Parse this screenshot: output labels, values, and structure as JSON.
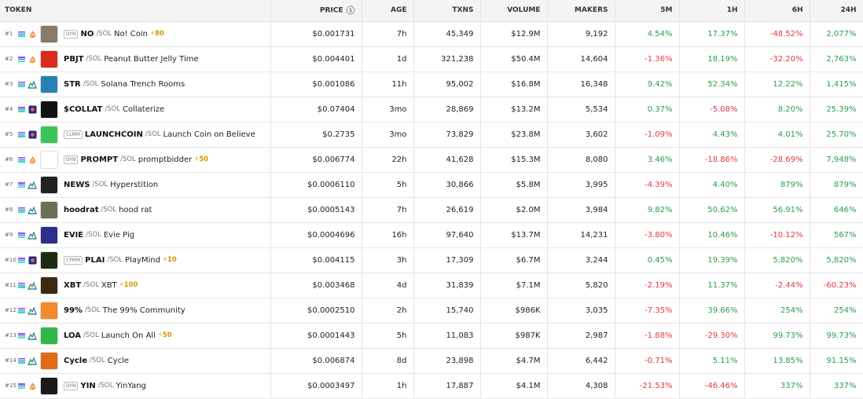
{
  "columns": {
    "token": "TOKEN",
    "price": "PRICE",
    "age": "AGE",
    "txns": "TXNS",
    "volume": "VOLUME",
    "makers": "MAKERS",
    "m5": "5M",
    "h1": "1H",
    "h6": "6H",
    "h24": "24H"
  },
  "colors": {
    "positive": "#2a9d4f",
    "negative": "#e0393e",
    "boost": "#d19a00",
    "header_bg": "#f4f4f5"
  },
  "rows": [
    {
      "rank": "#1",
      "dex": "fire-icon",
      "badge": "DYN",
      "symbol": "NO",
      "pair": "/SOL",
      "name": "No! Coin",
      "boost": "⚡80",
      "avatar_color": "#8a7a6a",
      "price": "$0.001731",
      "age": "7h",
      "txns": "45,349",
      "volume": "$12.9M",
      "makers": "9,192",
      "m5": "4.54%",
      "h1": "17.37%",
      "h6": "-48.52%",
      "h24": "2,077%"
    },
    {
      "rank": "#2",
      "dex": "fire-icon",
      "badge": "",
      "symbol": "PBJT",
      "pair": "/SOL",
      "name": "Peanut Butter Jelly Time",
      "boost": "",
      "avatar_color": "#d92c1c",
      "price": "$0.004401",
      "age": "1d",
      "txns": "321,238",
      "volume": "$50.4M",
      "makers": "14,604",
      "m5": "-1.36%",
      "h1": "18.19%",
      "h6": "-32.20%",
      "h24": "2,763%"
    },
    {
      "rank": "#3",
      "dex": "raydium-icon",
      "badge": "",
      "symbol": "STR",
      "pair": "/SOL",
      "name": "Solana Trench Rooms",
      "boost": "",
      "avatar_color": "#2a7fb5",
      "price": "$0.001086",
      "age": "11h",
      "txns": "95,002",
      "volume": "$16.8M",
      "makers": "16,348",
      "m5": "9.42%",
      "h1": "52.34%",
      "h6": "12.22%",
      "h24": "1,415%"
    },
    {
      "rank": "#4",
      "dex": "meteora-icon",
      "badge": "",
      "symbol": "$COLLAT",
      "pair": "/SOL",
      "name": "Collaterize",
      "boost": "",
      "avatar_color": "#111111",
      "price": "$0.07404",
      "age": "3mo",
      "txns": "28,869",
      "volume": "$13.2M",
      "makers": "5,534",
      "m5": "0.37%",
      "h1": "-5.08%",
      "h6": "8.20%",
      "h24": "25.39%"
    },
    {
      "rank": "#5",
      "dex": "meteora-icon",
      "badge": "CLMM",
      "symbol": "LAUNCHCOIN",
      "pair": "/SOL",
      "name": "Launch Coin on Believe",
      "boost": "",
      "avatar_color": "#3cc45a",
      "price": "$0.2735",
      "age": "3mo",
      "txns": "73,829",
      "volume": "$23.8M",
      "makers": "3,602",
      "m5": "-1.09%",
      "h1": "4.43%",
      "h6": "4.01%",
      "h24": "25.70%"
    },
    {
      "rank": "#6",
      "dex": "fire-icon",
      "badge": "DYN",
      "symbol": "PROMPT",
      "pair": "/SOL",
      "name": "promptbidder",
      "boost": "⚡50",
      "avatar_color": "#ffffff",
      "price": "$0.006774",
      "age": "22h",
      "txns": "41,628",
      "volume": "$15.3M",
      "makers": "8,080",
      "m5": "3.46%",
      "h1": "-18.86%",
      "h6": "-28.69%",
      "h24": "7,948%"
    },
    {
      "rank": "#7",
      "dex": "raydium-icon",
      "badge": "",
      "symbol": "NEWS",
      "pair": "/SOL",
      "name": "Hyperstition",
      "boost": "",
      "avatar_color": "#222222",
      "price": "$0.0006110",
      "age": "5h",
      "txns": "30,866",
      "volume": "$5.8M",
      "makers": "3,995",
      "m5": "-4.39%",
      "h1": "4.40%",
      "h6": "879%",
      "h24": "879%"
    },
    {
      "rank": "#8",
      "dex": "raydium-icon",
      "badge": "",
      "symbol": "hoodrat",
      "pair": "/SOL",
      "name": "hood rat",
      "boost": "",
      "avatar_color": "#6b6f5a",
      "price": "$0.0005143",
      "age": "7h",
      "txns": "26,619",
      "volume": "$2.0M",
      "makers": "3,984",
      "m5": "9.82%",
      "h1": "50.62%",
      "h6": "56.91%",
      "h24": "646%"
    },
    {
      "rank": "#9",
      "dex": "raydium-icon",
      "badge": "",
      "symbol": "EVIE",
      "pair": "/SOL",
      "name": "Evie Pig",
      "boost": "",
      "avatar_color": "#2b2f8a",
      "price": "$0.0004696",
      "age": "16h",
      "txns": "97,640",
      "volume": "$13.7M",
      "makers": "14,231",
      "m5": "-3.80%",
      "h1": "10.46%",
      "h6": "-10.12%",
      "h24": "567%"
    },
    {
      "rank": "#10",
      "dex": "meteora-icon",
      "badge": "CPMM",
      "symbol": "PLAI",
      "pair": "/SOL",
      "name": "PlayMind",
      "boost": "⚡10",
      "avatar_color": "#1e2a14",
      "price": "$0.004115",
      "age": "3h",
      "txns": "17,309",
      "volume": "$6.7M",
      "makers": "3,244",
      "m5": "0.45%",
      "h1": "19.39%",
      "h6": "5,820%",
      "h24": "5,820%"
    },
    {
      "rank": "#11",
      "dex": "raydium-icon",
      "badge": "",
      "symbol": "XBT",
      "pair": "/SOL",
      "name": "XBT",
      "boost": "⚡100",
      "avatar_color": "#3a2a10",
      "price": "$0.003468",
      "age": "4d",
      "txns": "31,839",
      "volume": "$7.1M",
      "makers": "5,820",
      "m5": "-2.19%",
      "h1": "11.37%",
      "h6": "-2.44%",
      "h24": "-60.23%"
    },
    {
      "rank": "#12",
      "dex": "raydium-icon",
      "badge": "",
      "symbol": "99%",
      "pair": "/SOL",
      "name": "The 99% Community",
      "boost": "",
      "avatar_color": "#f08a2a",
      "price": "$0.0002510",
      "age": "2h",
      "txns": "15,740",
      "volume": "$986K",
      "makers": "3,035",
      "m5": "-7.35%",
      "h1": "39.66%",
      "h6": "254%",
      "h24": "254%"
    },
    {
      "rank": "#13",
      "dex": "raydium-icon",
      "badge": "",
      "symbol": "LOA",
      "pair": "/SOL",
      "name": "Launch On All",
      "boost": "⚡50",
      "avatar_color": "#2fb84a",
      "price": "$0.0001443",
      "age": "5h",
      "txns": "11,083",
      "volume": "$987K",
      "makers": "2,987",
      "m5": "-1.88%",
      "h1": "-29.30%",
      "h6": "99.73%",
      "h24": "99.73%"
    },
    {
      "rank": "#14",
      "dex": "raydium-icon",
      "badge": "",
      "symbol": "Cycle",
      "pair": "/SOL",
      "name": "Cycle",
      "boost": "",
      "avatar_color": "#e06a18",
      "price": "$0.006874",
      "age": "8d",
      "txns": "23,898",
      "volume": "$4.7M",
      "makers": "6,442",
      "m5": "-0.71%",
      "h1": "5.11%",
      "h6": "13.85%",
      "h24": "91.15%"
    },
    {
      "rank": "#15",
      "dex": "fire-icon",
      "badge": "DYN",
      "symbol": "YIN",
      "pair": "/SOL",
      "name": "YinYang",
      "boost": "",
      "avatar_color": "#1a1a1a",
      "price": "$0.0003497",
      "age": "1h",
      "txns": "17,887",
      "volume": "$4.1M",
      "makers": "4,308",
      "m5": "-21.53%",
      "h1": "-46.46%",
      "h6": "337%",
      "h24": "337%"
    }
  ]
}
